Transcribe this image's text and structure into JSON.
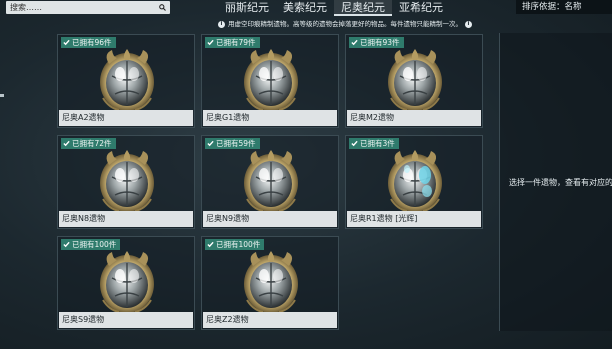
{
  "search": {
    "placeholder": "搜索……"
  },
  "tabs": [
    {
      "label": "丽斯纪元"
    },
    {
      "label": "美索纪元"
    },
    {
      "label": "尼奥纪元"
    },
    {
      "label": "亚希纪元"
    }
  ],
  "active_tab": "尼奥纪元",
  "sort": {
    "label": "排序依据：名称"
  },
  "info": {
    "text": "用虚空印痕精制遗物。高等级的遗物会掉落更好的物品。每件遗物只能精制一次。"
  },
  "relics": [
    {
      "owned": "已拥有96件",
      "name": "尼奥A2遗物",
      "icon": "relic-intact-icon"
    },
    {
      "owned": "已拥有79件",
      "name": "尼奥G1遗物",
      "icon": "relic-intact-icon"
    },
    {
      "owned": "已拥有93件",
      "name": "尼奥M2遗物",
      "icon": "relic-intact-icon"
    },
    {
      "owned": "已拥有72件",
      "name": "尼奥N8遗物",
      "icon": "relic-intact-icon"
    },
    {
      "owned": "已拥有59件",
      "name": "尼奥N9遗物",
      "icon": "relic-intact-icon"
    },
    {
      "owned": "已拥有3件",
      "name": "尼奥R1遗物 [光辉]",
      "icon": "relic-radiant-icon"
    },
    {
      "owned": "已拥有100件",
      "name": "尼奥S9遗物",
      "icon": "relic-intact-icon"
    },
    {
      "owned": "已拥有100件",
      "name": "尼奥Z2遗物",
      "icon": "relic-intact-icon"
    }
  ],
  "detail": {
    "prompt": "选择一件遗物，查看有对应的"
  },
  "colors": {
    "owned_badge": "#2f7b6c",
    "name_bar": "#dfe3e5",
    "background": "#1c282f",
    "radiant_glow": "#6fd3e8"
  }
}
